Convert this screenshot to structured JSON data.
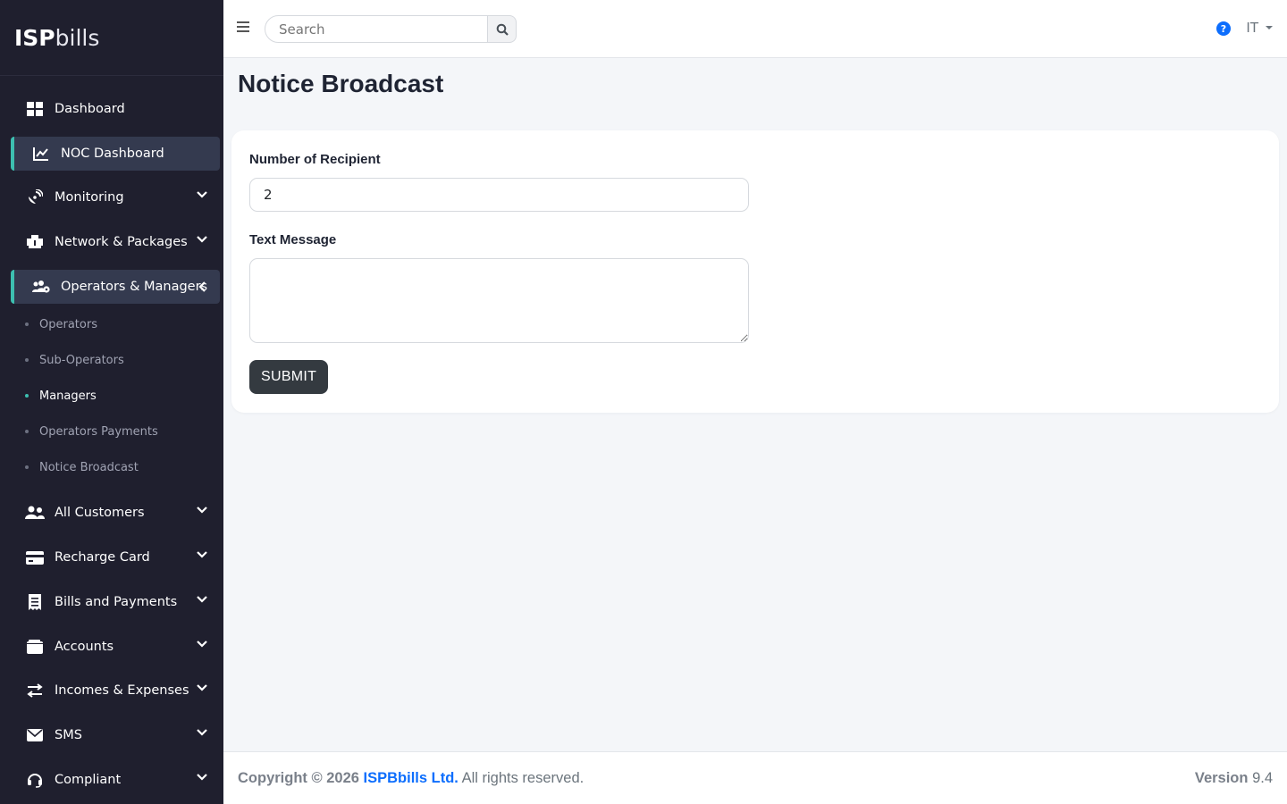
{
  "brand": {
    "part1": "ISP",
    "part2": "bills"
  },
  "sidebar": {
    "items": [
      {
        "label": "Dashboard",
        "icon": "dashboard-icon"
      },
      {
        "label": "NOC Dashboard",
        "icon": "chart-line-icon"
      },
      {
        "label": "Monitoring",
        "icon": "satellite-dish-icon"
      },
      {
        "label": "Network & Packages",
        "icon": "boxes-icon"
      },
      {
        "label": "Operators & Managers",
        "icon": "users-cog-icon"
      },
      {
        "label": "All Customers",
        "icon": "users-icon"
      },
      {
        "label": "Recharge Card",
        "icon": "credit-card-icon"
      },
      {
        "label": "Bills and Payments",
        "icon": "receipt-icon"
      },
      {
        "label": "Accounts",
        "icon": "wallet-icon"
      },
      {
        "label": "Incomes & Expenses",
        "icon": "exchange-icon"
      },
      {
        "label": "SMS",
        "icon": "envelope-icon"
      },
      {
        "label": "Compliant",
        "icon": "headset-icon"
      }
    ],
    "submenu": [
      "Operators",
      "Sub-Operators",
      "Managers",
      "Operators Payments",
      "Notice Broadcast"
    ]
  },
  "topbar": {
    "search_placeholder": "Search",
    "help_icon": "question-circle-icon",
    "language": "IT"
  },
  "page": {
    "title": "Notice Broadcast"
  },
  "form": {
    "recipient_label": "Number of Recipient",
    "recipient_value": "2",
    "message_label": "Text Message",
    "message_value": "",
    "submit_label": "SUBMIT"
  },
  "footer": {
    "copyright_prefix": "Copyright © 2026",
    "company": "ISPBbills Ltd.",
    "rights": "All rights reserved.",
    "version_label": "Version",
    "version_value": "9.4"
  },
  "colors": {
    "sidebar_bg": "#1f1f2e",
    "active_item_bg": "#343a4f",
    "accent": "#3dbfb0",
    "link": "#0d6efd",
    "button": "#343a40"
  }
}
